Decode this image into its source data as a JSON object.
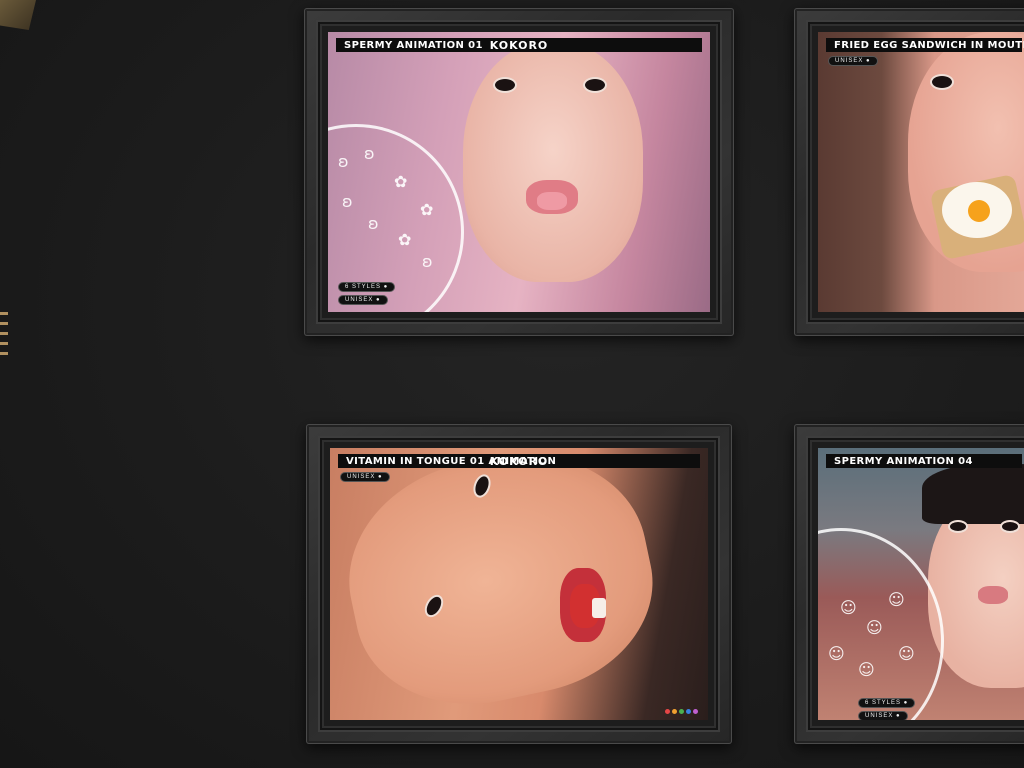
{
  "posters": [
    {
      "title": "SPERMY ANIMATION 01",
      "brand": "KOKORO",
      "pills": [
        "6 STYLES ●",
        "UNISEX ●"
      ]
    },
    {
      "title": "FRIED EGG SANDWICH IN MOUTH",
      "brand": "",
      "pills": [
        "UNISEX ●"
      ]
    },
    {
      "title": "VITAMIN IN TONGUE 01 ANIMATION",
      "brand": "KOKORO",
      "pills": [
        "UNISEX ●"
      ]
    },
    {
      "title": "SPERMY ANIMATION 04",
      "brand": "",
      "pills": [
        "6 STYLES ●",
        "UNISEX ●"
      ]
    }
  ],
  "colors": {
    "pink_bg": "#c98aa8",
    "pink_hair": "#e7a7bd",
    "skin_light": "#f2c4b4",
    "skin_warm": "#e9a080",
    "egg_yolk": "#f6a21c",
    "accent_red": "#d23030"
  }
}
